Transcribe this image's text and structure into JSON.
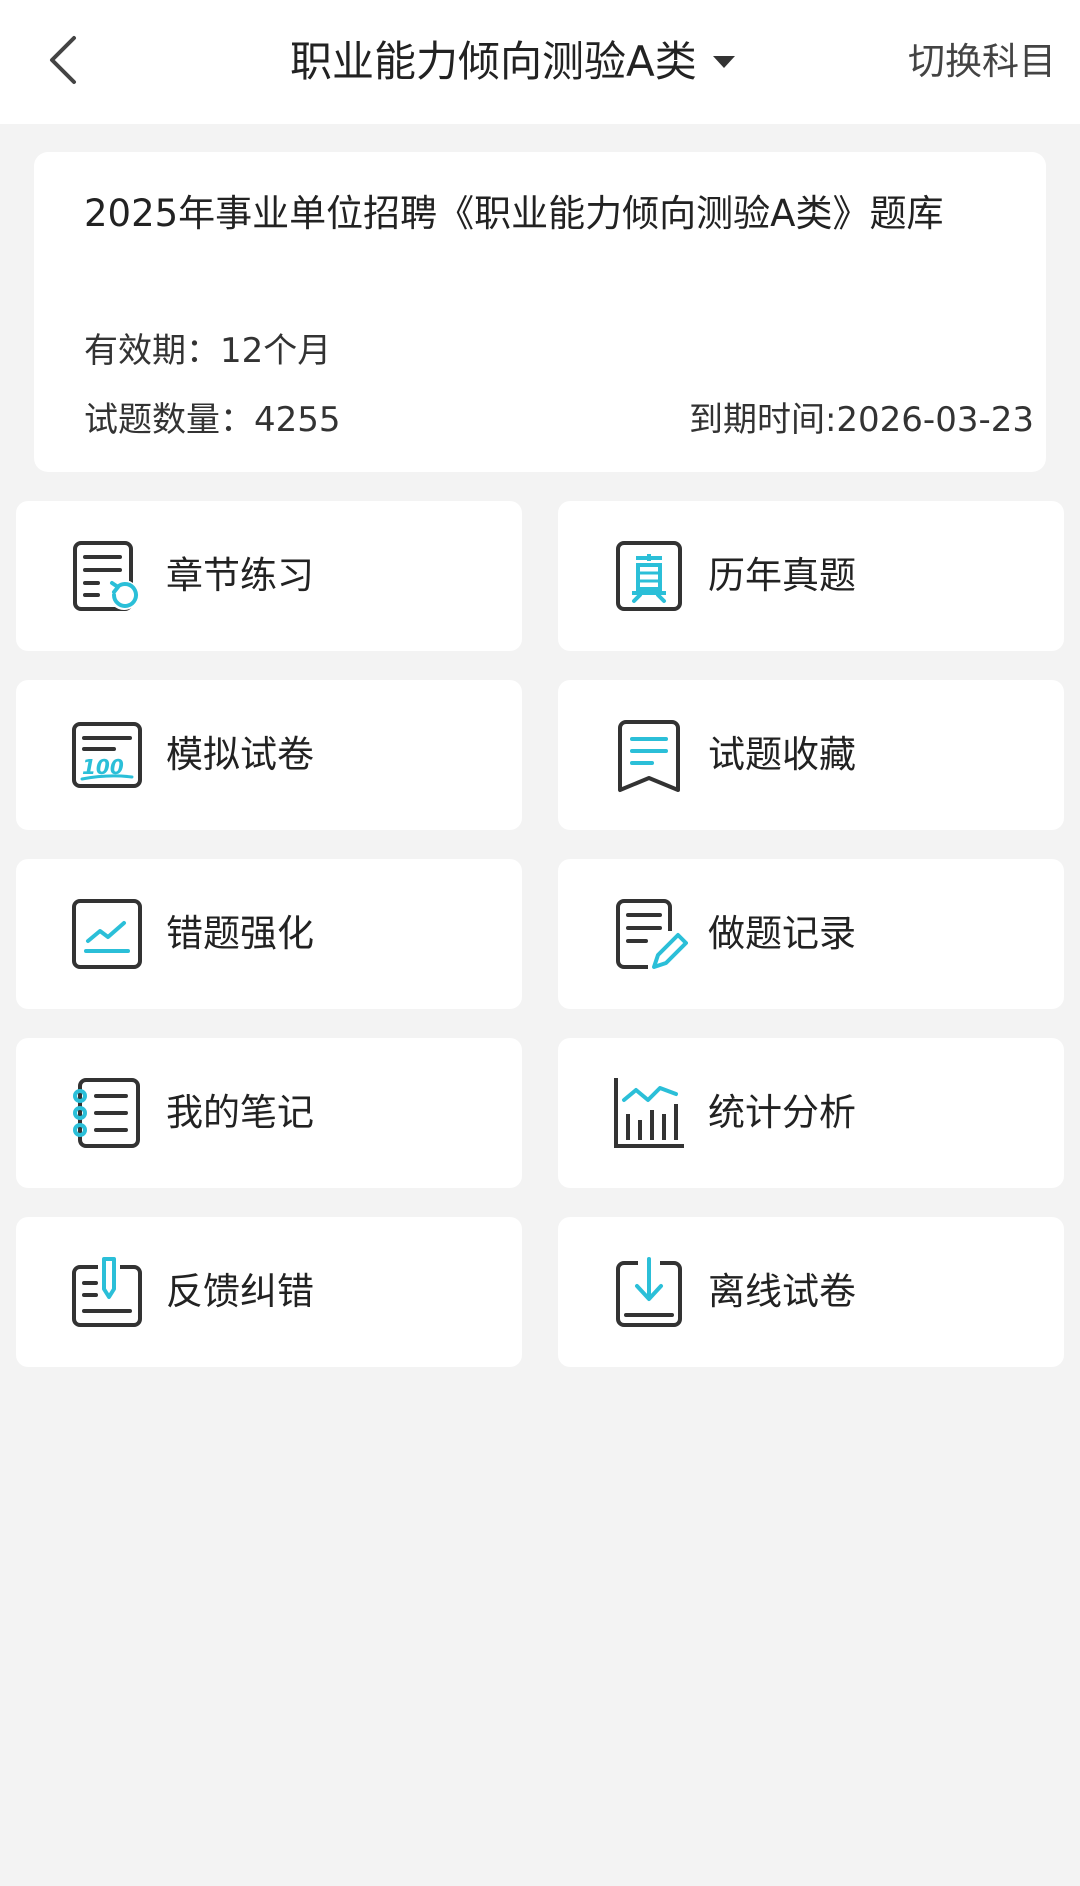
{
  "header": {
    "title": "职业能力倾向测验A类",
    "switch_label": "切换科目"
  },
  "info": {
    "title": "2025年事业单位招聘《职业能力倾向测验A类》题库",
    "validity": "有效期：12个月",
    "question_count": "试题数量：4255",
    "expiry": "到期时间:2026-03-23"
  },
  "menu": [
    {
      "label": "章节练习",
      "icon": "chapter-practice-icon"
    },
    {
      "label": "历年真题",
      "icon": "past-exams-icon"
    },
    {
      "label": "模拟试卷",
      "icon": "mock-paper-icon"
    },
    {
      "label": "试题收藏",
      "icon": "favorites-icon"
    },
    {
      "label": "错题强化",
      "icon": "wrong-questions-icon"
    },
    {
      "label": "做题记录",
      "icon": "practice-record-icon"
    },
    {
      "label": "我的笔记",
      "icon": "notes-icon"
    },
    {
      "label": "统计分析",
      "icon": "statistics-icon"
    },
    {
      "label": "反馈纠错",
      "icon": "feedback-icon"
    },
    {
      "label": "离线试卷",
      "icon": "offline-download-icon"
    }
  ],
  "colors": {
    "accent": "#2bbfd8",
    "stroke": "#333333",
    "background": "#f3f3f3"
  }
}
